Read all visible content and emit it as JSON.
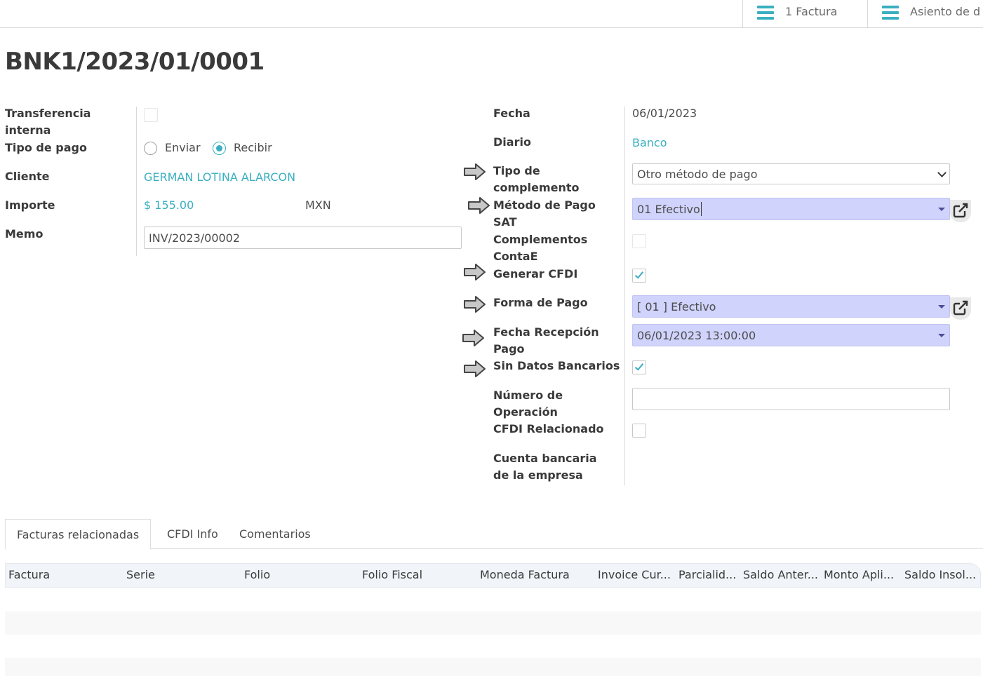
{
  "topbar": {
    "invoice_btn": "1 Factura",
    "entry_btn": "Asiento de d"
  },
  "record": {
    "title": "BNK1/2023/01/0001"
  },
  "left": {
    "internal_transfer_label": "Transferencia interna",
    "payment_type_label": "Tipo de pago",
    "payment_type_send": "Enviar",
    "payment_type_receive": "Recibir",
    "payment_type_selected": "Recibir",
    "internal_transfer_checked": false,
    "client_label": "Cliente",
    "client_value": "GERMAN LOTINA ALARCON",
    "amount_label": "Importe",
    "amount_value": "$ 155.00",
    "currency_value": "MXN",
    "memo_label": "Memo",
    "memo_value": "INV/2023/00002"
  },
  "right": {
    "date_label": "Fecha",
    "date_value": "06/01/2023",
    "journal_label": "Diario",
    "journal_value": "Banco",
    "complement_type_label": "Tipo de complemento",
    "complement_type_value": "Otro método de pago",
    "sat_method_label": "Método de Pago SAT",
    "sat_method_value": "01 Efectivo",
    "contae_label": "Complementos ContaE",
    "contae_checked": false,
    "gen_cfdi_label": "Generar CFDI",
    "gen_cfdi_checked": true,
    "payment_form_label": "Forma de Pago",
    "payment_form_value": "[ 01 ] Efectivo",
    "receipt_date_label": "Fecha Recepción Pago",
    "receipt_date_value": "06/01/2023 13:00:00",
    "no_bank_label": "Sin Datos Bancarios",
    "no_bank_checked": true,
    "operation_number_label": "Número de Operación",
    "operation_number_value": "",
    "related_cfdi_label": "CFDI Relacionado",
    "related_cfdi_checked": false,
    "company_bank_label": "Cuenta bancaria de la empresa"
  },
  "tabs": [
    "Facturas relacionadas",
    "CFDI Info",
    "Comentarios"
  ],
  "active_tab": "Facturas relacionadas",
  "table": {
    "columns": [
      "Factura",
      "Serie",
      "Folio",
      "Folio Fiscal",
      "Moneda Factura",
      "Invoice Cur...",
      "Parcialid...",
      "Saldo Anter...",
      "Monto Apli...",
      "Saldo Insol..."
    ]
  },
  "colors": {
    "accent": "#3aafc1",
    "highlight": "#d0d3fb"
  },
  "icons": [
    "menu-icon",
    "external-link-icon",
    "arrow-right-icon",
    "chevron-down-icon"
  ]
}
